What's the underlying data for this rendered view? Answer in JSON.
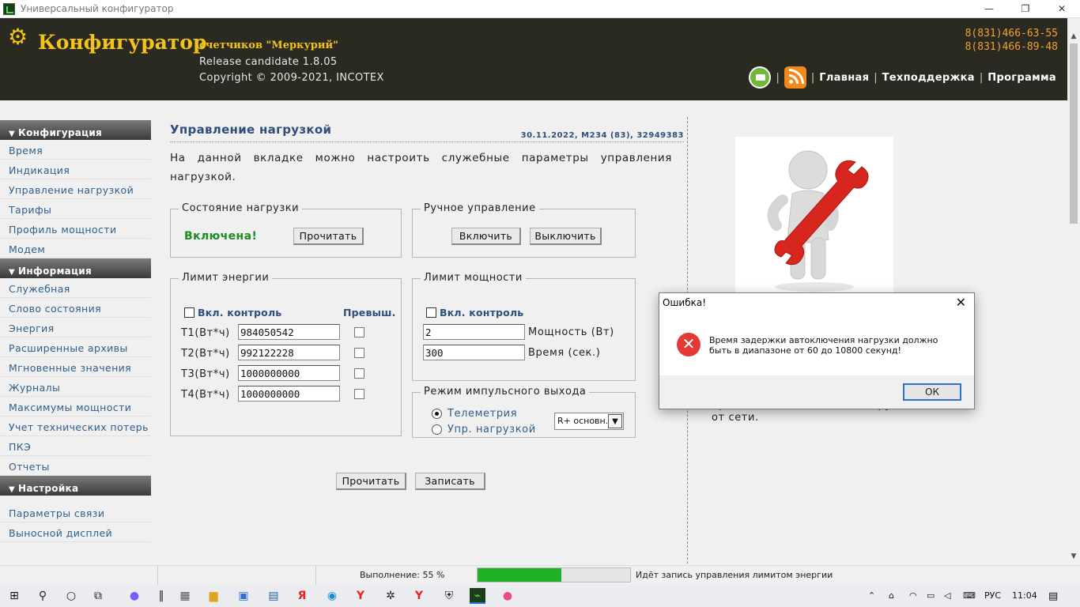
{
  "window": {
    "title": "Универсальный конфигуратор",
    "minimize": "—",
    "restore": "❐",
    "close": "✕"
  },
  "header": {
    "brand": "Конфигуратор",
    "subbrand": "счетчиков \"Меркурий\"",
    "release": "Release candidate 1.8.05",
    "copyright": "Copyright © 2009-2021, INCOTEX",
    "phone1": "8(831)466-63-55",
    "phone2": "8(831)466-89-48",
    "nav": [
      "Главная",
      "Техподдержка",
      "Программа"
    ],
    "separator": "|"
  },
  "sidebar": {
    "sections": [
      {
        "title": "Конфигурация",
        "items": [
          "Время",
          "Индикация",
          "Управление нагрузкой",
          "Тарифы",
          "Профиль мощности",
          "Модем"
        ]
      },
      {
        "title": "Информация",
        "items": [
          "Служебная",
          "Слово состояния",
          "Энергия",
          "Расширенные архивы",
          "Мгновенные значения",
          "Журналы",
          "Максимумы мощности",
          "Учет технических потерь",
          "ПКЭ",
          "Отчеты"
        ]
      },
      {
        "title": "Настройка",
        "items": [
          "Параметры связи",
          "Выносной дисплей"
        ]
      }
    ]
  },
  "main": {
    "title": "Управление нагрузкой",
    "meta": "30.11.2022, M234 (83), 32949383",
    "intro": "На данной вкладке можно настроить служебные параметры управления нагрузкой.",
    "load_state": {
      "legend": "Состояние нагрузки",
      "status": "Включена!",
      "read_button": "Прочитать"
    },
    "manual": {
      "legend": "Ручное управление",
      "on_button": "Включить",
      "off_button": "Выключить"
    },
    "energy_limit": {
      "legend": "Лимит энергии",
      "control_label": "Вкл. контроль",
      "exceed_label": "Превыш.",
      "rows": [
        {
          "label": "T1(Вт*ч)",
          "value": "984050542"
        },
        {
          "label": "T2(Вт*ч)",
          "value": "992122228"
        },
        {
          "label": "T3(Вт*ч)",
          "value": "1000000000"
        },
        {
          "label": "T4(Вт*ч)",
          "value": "1000000000"
        }
      ]
    },
    "power_limit": {
      "legend": "Лимит мощности",
      "control_label": "Вкл. контроль",
      "power_value": "2",
      "power_label": "Мощность (Вт)",
      "time_value": "300",
      "time_label": "Время (сек.)"
    },
    "pulse": {
      "legend": "Режим импульсного выхода",
      "options": [
        "Телеметрия",
        "Упр. нагрузкой"
      ],
      "selected": "R+ основн."
    },
    "read_button": "Прочитать",
    "write_button": "Записать"
  },
  "aside": {
    "text_line1": "производит отключение нагрузки",
    "text_line2": "от сети."
  },
  "dialog": {
    "title": "Ошибка!",
    "message": "Время задержки автоключения нагрузки должно быть в диапазоне от 60 до 10800 секунд!",
    "ok": "ОК",
    "close": "✕"
  },
  "statusbar": {
    "progress_text": "Выполнение: 55 %",
    "progress": 55,
    "message": "Идёт запись управления лимитом энергии"
  },
  "taskbar": {
    "lang": "РУС",
    "time": "11:04"
  },
  "colors": {
    "header_bg": "#2b2a22",
    "brand": "#f2c318",
    "phones": "#f2a22a",
    "link": "#2f5e8c",
    "status_on": "#1e8b24"
  }
}
